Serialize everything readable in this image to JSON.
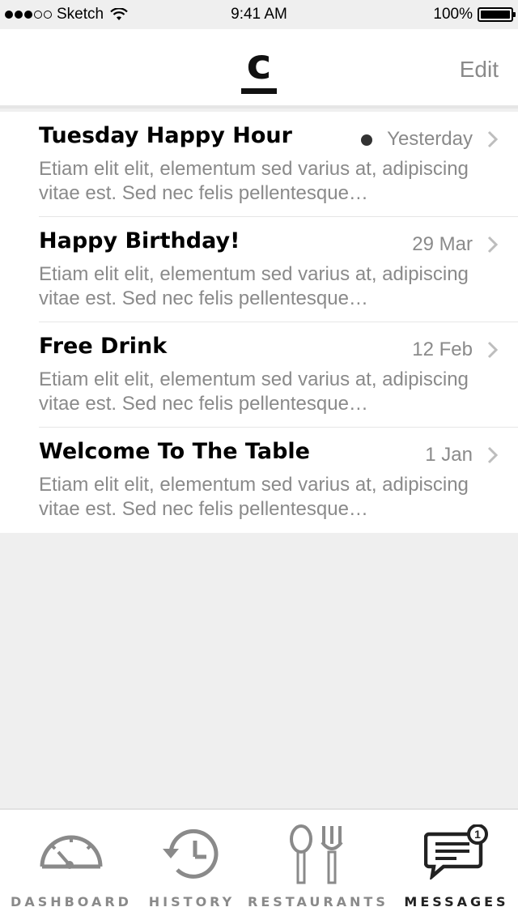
{
  "status_bar": {
    "carrier": "Sketch",
    "time": "9:41 AM",
    "battery": "100%",
    "battery_level": 1.0,
    "signal_bars": 3
  },
  "navbar": {
    "logo_letter": "c",
    "edit_label": "Edit"
  },
  "messages": [
    {
      "title": "Tuesday Happy Hour",
      "date": "Yesterday",
      "unread": true,
      "body": "Etiam elit elit, elementum sed varius at, adipiscing vitae est. Sed nec felis pellentesque…"
    },
    {
      "title": "Happy Birthday!",
      "date": "29 Mar",
      "unread": false,
      "body": "Etiam elit elit, elementum sed varius at, adipiscing vitae est. Sed nec felis pellentesque…"
    },
    {
      "title": "Free Drink",
      "date": "12 Feb",
      "unread": false,
      "body": "Etiam elit elit, elementum sed varius at, adipiscing vitae est. Sed nec felis pellentesque…"
    },
    {
      "title": "Welcome To The Table",
      "date": "1 Jan",
      "unread": false,
      "body": "Etiam elit elit, elementum sed varius at, adipiscing vitae est. Sed nec felis pellentesque…"
    }
  ],
  "tabbar": {
    "tabs": [
      {
        "label": "DASHBOARD",
        "icon": "speedometer-icon",
        "active": false
      },
      {
        "label": "HISTORY",
        "icon": "history-icon",
        "active": false
      },
      {
        "label": "RESTAURANTS",
        "icon": "fork-spoon-icon",
        "active": false
      },
      {
        "label": "MESSAGES",
        "icon": "messages-icon",
        "active": true,
        "badge": "1"
      }
    ]
  },
  "colors": {
    "background": "#efefef",
    "text_primary": "#000000",
    "text_secondary": "#8a8a8a",
    "icon_inactive": "#8a8a8a",
    "icon_active": "#222222"
  }
}
